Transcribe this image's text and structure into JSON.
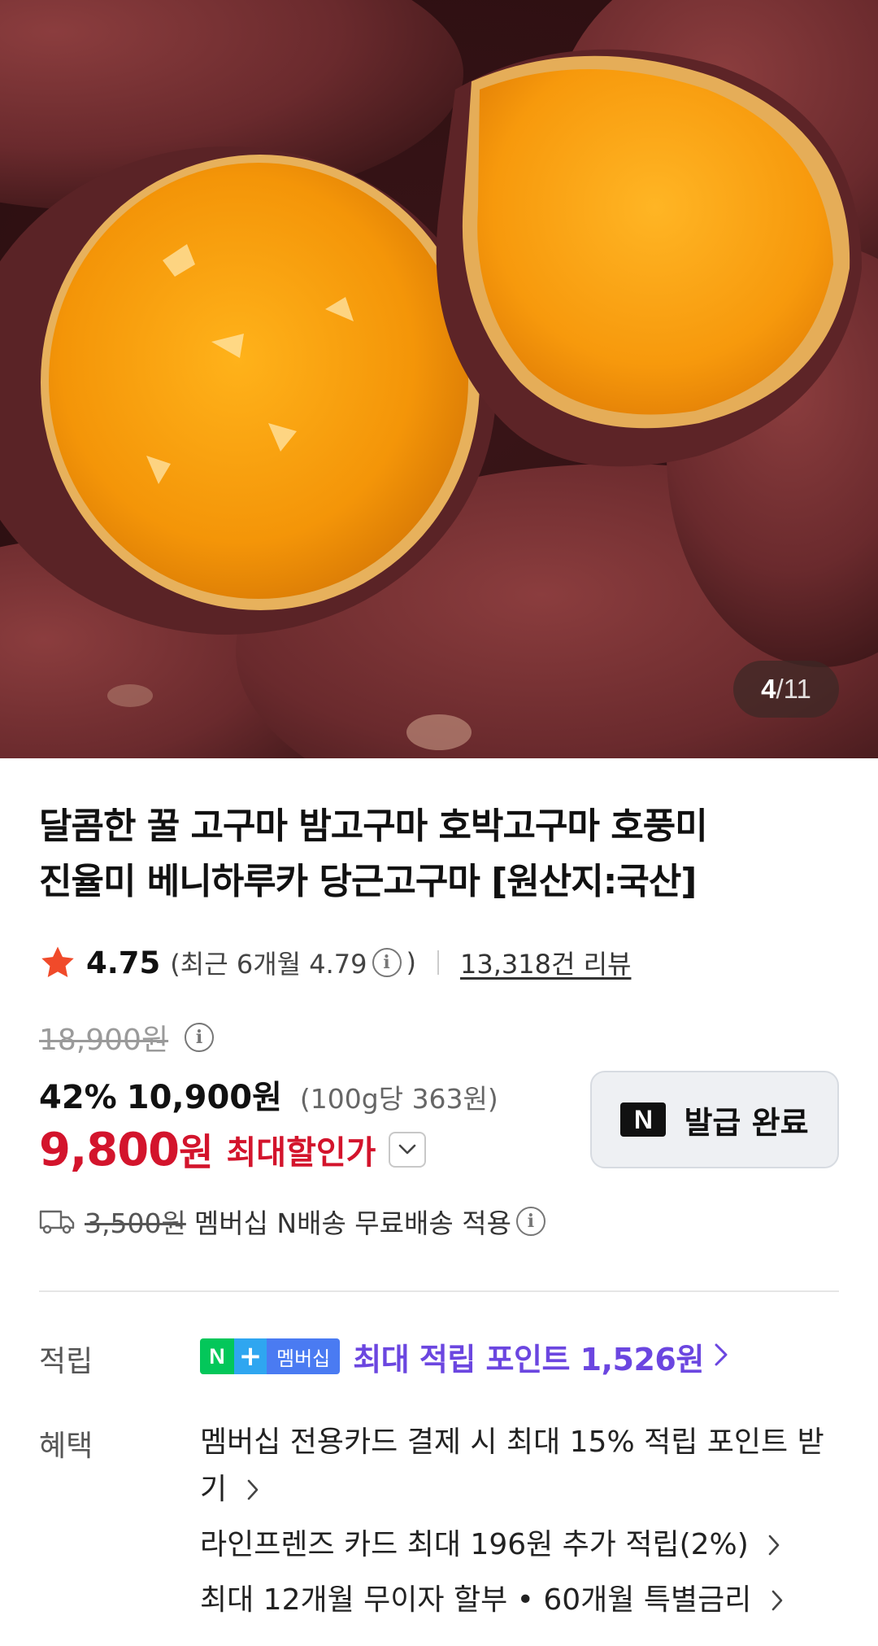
{
  "gallery": {
    "current": "4",
    "separator": "/",
    "total": "11"
  },
  "product": {
    "title_line1": "달콤한 꿀 고구마 밤고구마 호박고구마 호풍미",
    "title_line2": "진율미 베니하루카 당근고구마 [원산지:국산]"
  },
  "rating": {
    "score": "4.75",
    "recent_prefix": "(최근 6개월 4.79",
    "recent_suffix": ")",
    "reviews": "13,318건 리뷰"
  },
  "price": {
    "original": "18,900원",
    "discount_rate": "42%",
    "sale": "10,900원",
    "unit_price": "(100g당 363원)",
    "best": "9,800",
    "best_unit": "원",
    "best_label": "최대할인가"
  },
  "coupon": {
    "logo": "N",
    "label": "발급 완료"
  },
  "shipping": {
    "original_fee": "3,500원",
    "text": "멤버십 N배송 무료배송 적용"
  },
  "points": {
    "label": "적립",
    "badge_n": "N",
    "badge_plus": "+",
    "badge_member": "멤버십",
    "text": "최대 적립 포인트 1,526원"
  },
  "benefits": {
    "label": "혜택",
    "items": [
      "멤버십 전용카드 결제 시 최대 15% 적립 포인트 받기",
      "라인프렌즈 카드 최대 196원 추가 적립(2%)",
      "최대 12개월 무이자 할부 • 60개월 특별금리"
    ]
  },
  "colors": {
    "accent_red": "#d3142c",
    "star": "#f04a2a",
    "points_purple": "#6b46e0",
    "naver_green": "#03c75a"
  },
  "icons": {
    "rating": "star-icon",
    "info": "info-icon",
    "shipping": "truck-icon",
    "expand": "chevron-down-icon",
    "more": "chevron-right-icon"
  }
}
